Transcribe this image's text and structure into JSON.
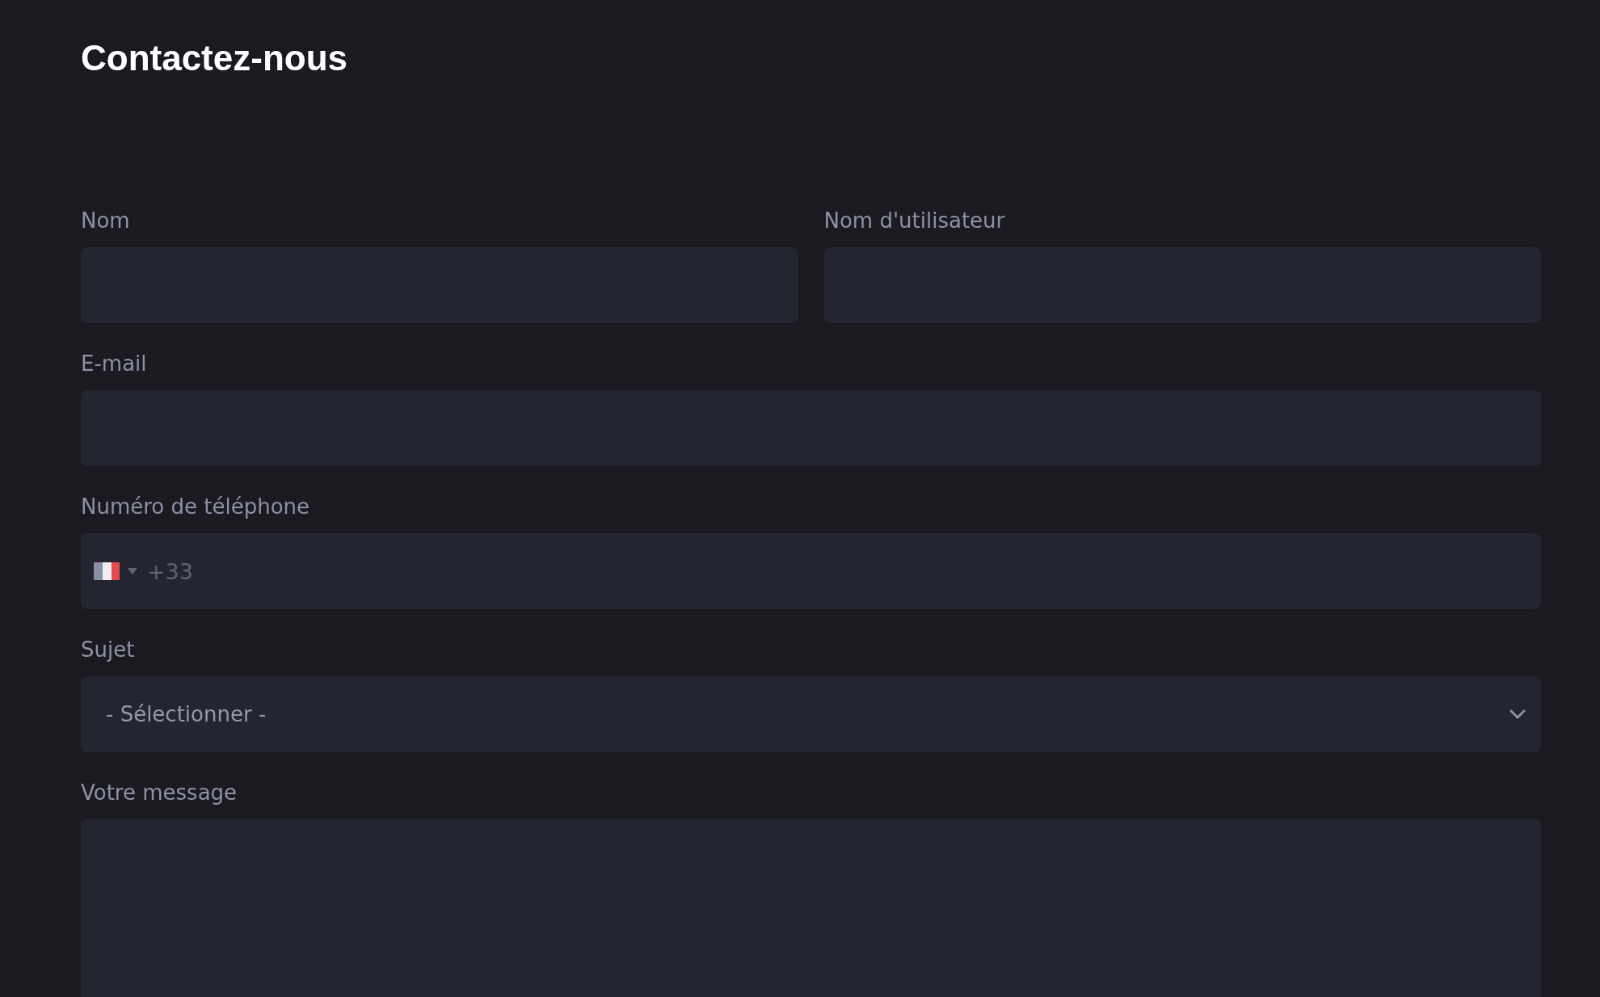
{
  "title": "Contactez-nous",
  "rows": [
    {
      "fields": [
        {
          "kind": "text",
          "label": "Nom"
        },
        {
          "kind": "text",
          "label": "Nom d'utilisateur"
        }
      ]
    },
    {
      "fields": [
        {
          "kind": "email",
          "label": "E-mail"
        }
      ]
    },
    {
      "fields": [
        {
          "kind": "phone",
          "label": "Numéro de téléphone",
          "placeholder": "+33"
        }
      ]
    },
    {
      "fields": [
        {
          "kind": "select",
          "label": "Sujet",
          "value": "- Sélectionner -"
        }
      ]
    },
    {
      "fields": [
        {
          "kind": "textarea",
          "label": "Votre message"
        }
      ]
    }
  ]
}
